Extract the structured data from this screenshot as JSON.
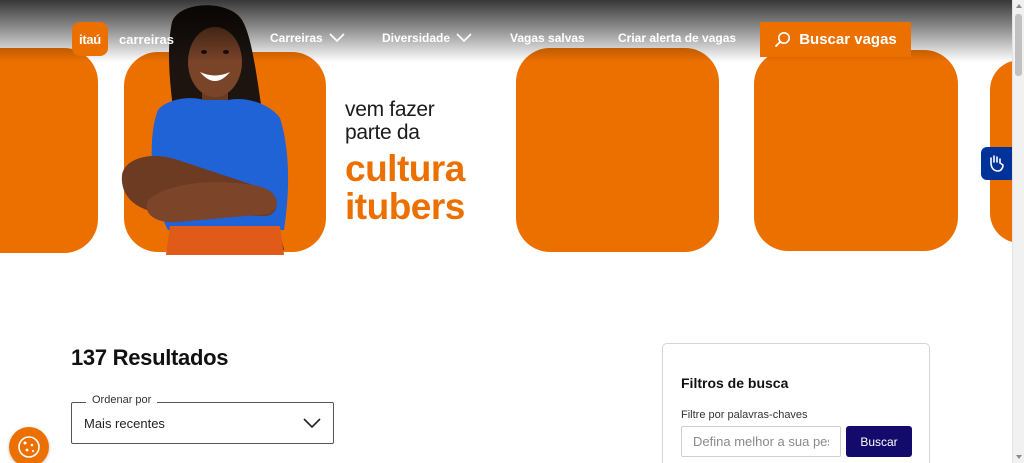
{
  "header": {
    "logo_text": "itaú",
    "brand_suffix": "carreiras",
    "nav": [
      {
        "label": "Carreiras"
      },
      {
        "label": "Diversidade"
      },
      {
        "label": "Vagas salvas"
      },
      {
        "label": "Criar alerta de vagas"
      }
    ],
    "search_button_label": "Buscar vagas"
  },
  "hero": {
    "line1": "vem fazer",
    "line2": "parte da",
    "highlight1": "cultura",
    "highlight2": "itubers"
  },
  "results": {
    "count_title": "137 Resultados",
    "sort_label": "Ordenar por",
    "sort_value": "Mais recentes"
  },
  "filters": {
    "title": "Filtros de busca",
    "keyword_label": "Filtre por palavras-chaves",
    "keyword_placeholder": "Defina melhor a sua pesquisa",
    "keyword_value": "",
    "search_button_label": "Buscar"
  },
  "colors": {
    "brand_orange": "#ec7000",
    "navy_button": "#120b6b",
    "accessibility_blue": "#003399"
  },
  "icons": {
    "search": "magnifier-icon",
    "chevron": "chevron-down-icon",
    "accessibility": "sign-language-icon",
    "cookie": "cookie-icon"
  }
}
